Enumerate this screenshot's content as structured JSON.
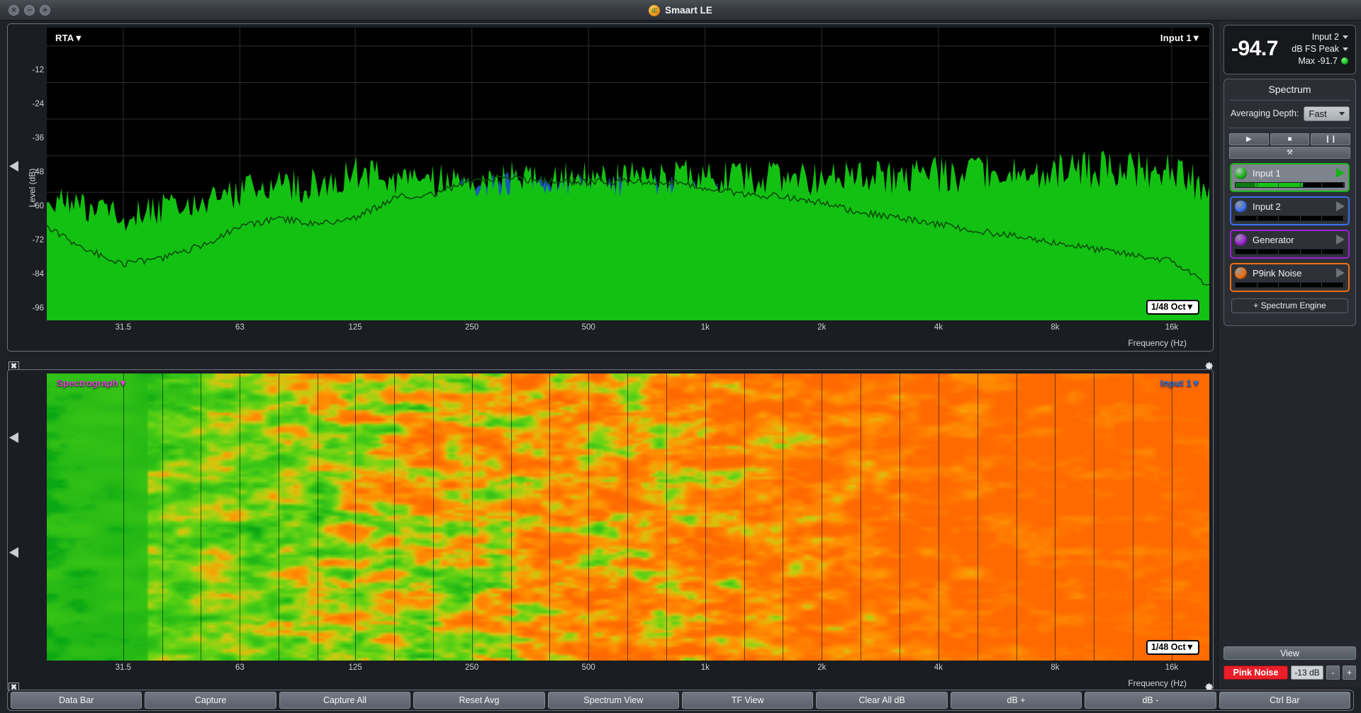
{
  "window": {
    "title": "Smaart LE",
    "logo_icon": "smaart-logo-icon",
    "close_label": "×",
    "minimize_label": "−",
    "maximize_label": "+"
  },
  "meter": {
    "value": "-94.7",
    "source": "Input 2",
    "unit": "dB FS Peak",
    "max_label": "Max -91.7",
    "status_color": "#17a81f"
  },
  "spectrum_panel": {
    "title": "Spectrum",
    "averaging_label": "Averaging Depth:",
    "averaging_value": "Fast",
    "transport": [
      {
        "name": "play",
        "glyph": "▶"
      },
      {
        "name": "stop",
        "glyph": "■"
      },
      {
        "name": "pause",
        "glyph": "❙❙"
      }
    ],
    "tools_glyph": "⚒",
    "add_engine_label": "+ Spectrum Engine"
  },
  "channels": [
    {
      "name": "Input 1",
      "color": "#17b317",
      "selected": true,
      "level": 0.62
    },
    {
      "name": "Input 2",
      "color": "#3a6ff0",
      "selected": false,
      "level": 0
    },
    {
      "name": "Generator",
      "color": "#9b22d6",
      "selected": false,
      "level": 0
    },
    {
      "name": "P9ink Noise",
      "color": "#f07010",
      "selected": false,
      "level": 0
    }
  ],
  "view_controls": {
    "view_label": "View",
    "pink_noise_label": "Pink Noise",
    "pink_noise_color": "#e81f29",
    "noise_db": "-13 dB",
    "minus_label": "-",
    "plus_label": "+"
  },
  "bottom_bar": {
    "buttons": [
      "Data Bar",
      "Capture",
      "Capture All",
      "Reset Avg",
      "Spectrum View",
      "TF View",
      "Clear All dB",
      "dB +",
      "dB -",
      "Ctrl Bar"
    ]
  },
  "rta": {
    "title": "RTA",
    "title_caret": "▼",
    "source": "Input 1",
    "source_caret": "▼",
    "resolution": "1/48 Oct",
    "resolution_caret": "▼",
    "close_icon": "close-icon",
    "gear_icon": "gear-icon"
  },
  "spectrograph": {
    "title": "Spectrograph",
    "title_caret": "▼",
    "title_color": "#e040e0",
    "source": "Input 1",
    "source_caret": "▼",
    "source_color": "#1f6fe0",
    "resolution": "1/48 Oct",
    "resolution_caret": "▼"
  },
  "chart_data": [
    {
      "type": "area",
      "id": "rta",
      "title": "RTA",
      "xlabel": "Frequency (Hz)",
      "ylabel": "Level (dB)",
      "ylim": [
        -102,
        -6
      ],
      "yticks": [
        -12,
        -24,
        -36,
        -48,
        -60,
        -72,
        -84,
        -96
      ],
      "xlim_hz": [
        20,
        20000
      ],
      "xticks_hz": [
        31.5,
        63,
        125,
        250,
        500,
        1000,
        2000,
        4000,
        8000,
        16000
      ],
      "xtick_labels": [
        "31.5",
        "63",
        "125",
        "250",
        "500",
        "1k",
        "2k",
        "4k",
        "8k",
        "16k"
      ],
      "grid": true,
      "log_x": true,
      "legend": [
        "Input 1",
        "Input 2"
      ],
      "series": [
        {
          "name": "Input 1",
          "color": "#12c112",
          "x_hz": [
            20,
            25,
            31.5,
            40,
            50,
            63,
            80,
            100,
            125,
            160,
            200,
            250,
            315,
            400,
            500,
            630,
            800,
            1000,
            1250,
            1600,
            2000,
            2500,
            3150,
            4000,
            5000,
            6300,
            8000,
            10000,
            12500,
            16000,
            20000
          ],
          "values_db": [
            -62,
            -66,
            -70,
            -66,
            -63,
            -61,
            -60,
            -59,
            -55,
            -57,
            -57,
            -57,
            -57,
            -57,
            -57,
            -57,
            -57,
            -56,
            -57,
            -57,
            -57,
            -57,
            -56,
            -56,
            -55,
            -55,
            -55,
            -54,
            -54,
            -55,
            -60
          ]
        },
        {
          "name": "Input 2",
          "color": "#1a5fbf",
          "x_hz": [
            20,
            25,
            31.5,
            40,
            50,
            63,
            80,
            100,
            125,
            160,
            200,
            250,
            315,
            400,
            500,
            630,
            800,
            1000,
            1250,
            1600,
            2000,
            2500,
            3150,
            4000,
            5000,
            6300,
            8000,
            10000,
            12500,
            16000,
            20000
          ],
          "values_db": [
            -73,
            -80,
            -85,
            -83,
            -79,
            -73,
            -70,
            -72,
            -70,
            -63,
            -62,
            -58,
            -57,
            -58,
            -58,
            -58,
            -58,
            -60,
            -62,
            -63,
            -65,
            -68,
            -70,
            -72,
            -74,
            -76,
            -78,
            -80,
            -82,
            -84,
            -92
          ]
        }
      ]
    },
    {
      "type": "heatmap",
      "id": "spectrograph",
      "title": "Spectrograph",
      "xlabel": "Frequency (Hz)",
      "xticks_hz": [
        31.5,
        63,
        125,
        250,
        500,
        1000,
        2000,
        4000,
        8000,
        16000
      ],
      "xtick_labels": [
        "31.5",
        "63",
        "125",
        "250",
        "500",
        "1k",
        "2k",
        "4k",
        "8k",
        "16k"
      ],
      "log_x": true,
      "colormap": [
        "#0aa814",
        "#6ed419",
        "#c8e014",
        "#ff9c00",
        "#ff6a00"
      ],
      "description": "Time-vs-frequency magnitude map: green at low frequencies, transitioning to orange above ~100 Hz."
    }
  ]
}
